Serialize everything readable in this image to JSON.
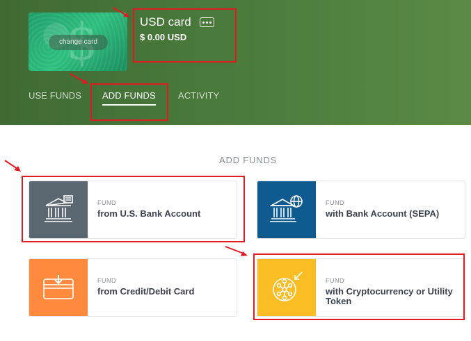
{
  "header": {
    "card_button_label": "change card",
    "card_title": "USD card",
    "card_balance": "$ 0.00 USD",
    "colors": {
      "header_bg": "#4a7a3b",
      "card_bg": "#2fbf7e",
      "highlight": "#e01b22"
    }
  },
  "tabs": [
    {
      "label": "USE FUNDS",
      "active": false
    },
    {
      "label": "ADD FUNDS",
      "active": true
    },
    {
      "label": "ACTIVITY",
      "active": false
    }
  ],
  "section": {
    "title": "ADD FUNDS"
  },
  "fund_options": [
    {
      "label": "FUND",
      "description": "from U.S. Bank Account",
      "icon": "bank-icon",
      "color": "#5a6670"
    },
    {
      "label": "FUND",
      "description": "with Bank Account (SEPA)",
      "icon": "bank-globe-icon",
      "color": "#0f5a8f"
    },
    {
      "label": "FUND",
      "description": "from Credit/Debit Card",
      "icon": "card-download-icon",
      "color": "#ff8a3d"
    },
    {
      "label": "FUND",
      "description": "with Cryptocurrency or Utility Token",
      "icon": "crypto-coin-icon",
      "color": "#fbbd24"
    }
  ]
}
